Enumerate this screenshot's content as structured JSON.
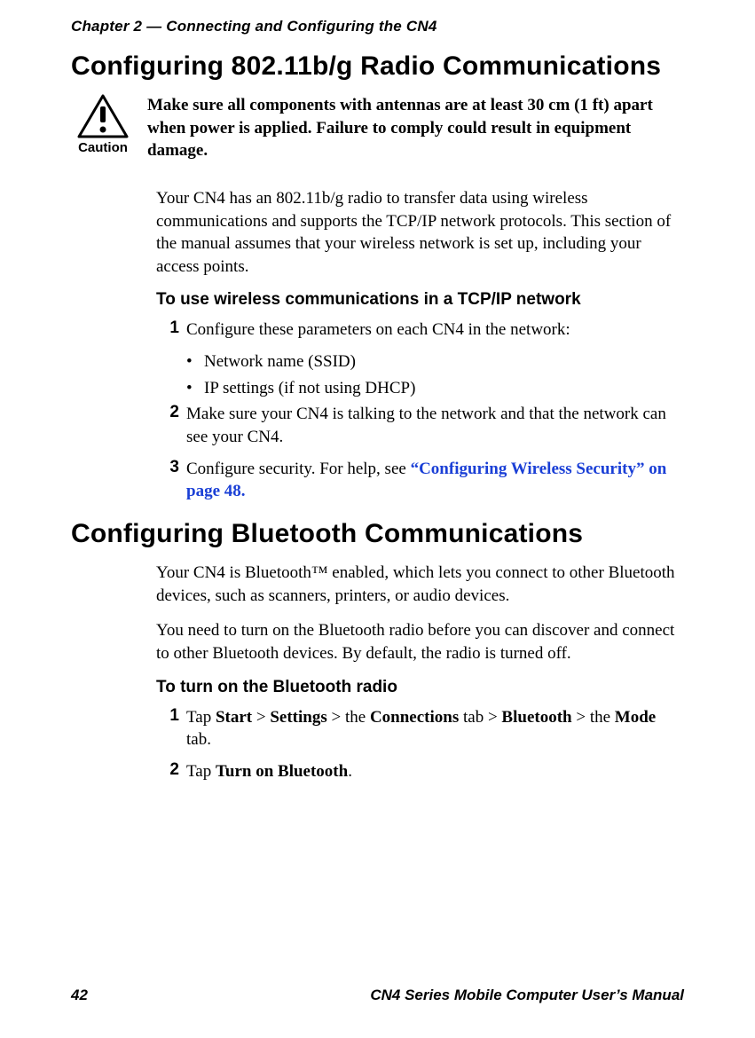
{
  "header": {
    "running_head": "Chapter 2 — Connecting and Configuring the CN4"
  },
  "section1": {
    "title": "Configuring 802.11b/g Radio Communications",
    "caution_label": "Caution",
    "caution_text": "Make sure all components with antennas are at least 30 cm (1 ft) apart when power is applied. Failure to comply could result in equipment damage.",
    "intro": "Your CN4 has an 802.11b/g radio to transfer data using wireless communications and supports the TCP/IP network protocols. This section of the manual assumes that your wireless network is set up, including your access points.",
    "subhead": "To use wireless communications in a TCP/IP network",
    "steps": {
      "s1_num": "1",
      "s1_text": "Configure these parameters on each CN4 in the network:",
      "s1_b1": "Network name (SSID)",
      "s1_b2": "IP settings (if not using DHCP)",
      "s2_num": "2",
      "s2_text": "Make sure your CN4 is talking to the network and that the network can see your CN4.",
      "s3_num": "3",
      "s3_pre": "Configure security. For help, see ",
      "s3_link": "“Configuring Wireless Security” on page 48."
    }
  },
  "section2": {
    "title": "Configuring Bluetooth Communications",
    "p1": "Your CN4 is Bluetooth™ enabled, which lets you connect to other Bluetooth devices, such as scanners, printers, or audio devices.",
    "p2": "You need to turn on the Bluetooth radio before you can discover and connect to other Bluetooth devices. By default, the radio is turned off.",
    "subhead": "To turn on the Bluetooth radio",
    "steps": {
      "s1_num": "1",
      "s1_parts": {
        "a": "Tap ",
        "b": "Start",
        "c": " > ",
        "d": "Settings",
        "e": " > the ",
        "f": "Connections",
        "g": " tab > ",
        "h": "Bluetooth",
        "i": " > the ",
        "j": "Mode",
        "k": " tab."
      },
      "s2_num": "2",
      "s2_parts": {
        "a": "Tap ",
        "b": "Turn on Bluetooth",
        "c": "."
      }
    }
  },
  "footer": {
    "page": "42",
    "title": "CN4 Series Mobile Computer User’s Manual"
  }
}
